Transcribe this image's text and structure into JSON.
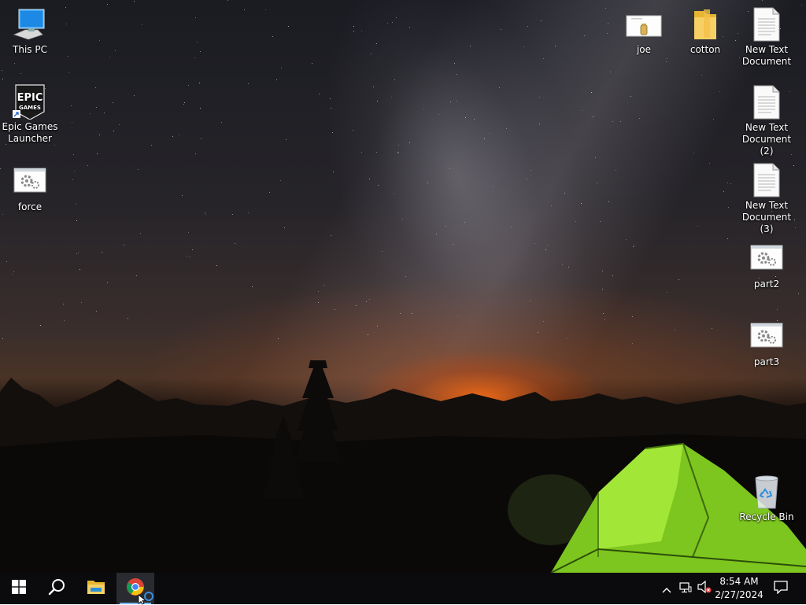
{
  "desktop": {
    "icons_left": [
      {
        "label": "This PC",
        "icon": "this-pc-icon"
      },
      {
        "label": "Epic Games Launcher",
        "icon": "epic-games-icon"
      },
      {
        "label": "force",
        "icon": "batch-file-icon"
      }
    ],
    "icons_right": [
      {
        "label": "joe",
        "icon": "image-file-icon"
      },
      {
        "label": "cotton",
        "icon": "folder-icon"
      },
      {
        "label": "New Text Document",
        "icon": "text-document-icon"
      },
      {
        "label": "New Text Document (2)",
        "icon": "text-document-icon"
      },
      {
        "label": "New Text Document (3)",
        "icon": "text-document-icon"
      },
      {
        "label": "part2",
        "icon": "batch-file-icon"
      },
      {
        "label": "part3",
        "icon": "batch-file-icon"
      },
      {
        "label": "Recycle Bin",
        "icon": "recycle-bin-icon"
      }
    ]
  },
  "taskbar": {
    "start_icon": "windows-logo-icon",
    "search_icon": "search-icon",
    "pinned": [
      {
        "name": "file-explorer",
        "icon": "folder-icon"
      },
      {
        "name": "google-chrome",
        "icon": "chrome-icon",
        "active": true
      }
    ],
    "tray": {
      "chevron_icon": "chevron-up-icon",
      "network_icon": "network-icon",
      "volume_icon": "volume-muted-icon"
    },
    "clock": {
      "time": "8:54 AM",
      "date": "2/27/2024"
    },
    "notifications_icon": "action-center-icon"
  },
  "colors": {
    "taskbar_bg": "#0b0b0d",
    "accent": "#76b9ed",
    "tent_green": "#9be22f"
  }
}
